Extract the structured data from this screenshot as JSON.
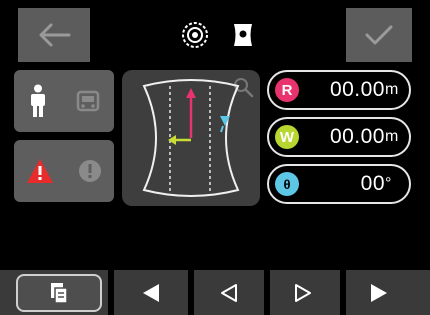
{
  "toolbar": {
    "back_icon": "arrow-left-icon",
    "confirm_icon": "checkmark-icon",
    "mode_icons": [
      "target-ring-icon",
      "shield-block-icon"
    ]
  },
  "side_panel": {
    "row1_icons": [
      "person-icon",
      "vehicle-icon"
    ],
    "row2_icons": [
      "warning-triangle-icon",
      "info-circle-icon"
    ]
  },
  "readouts": [
    {
      "badge": "R",
      "value": "00.00",
      "unit": "m",
      "color": "#e8336e"
    },
    {
      "badge": "W",
      "value": "00.00",
      "unit": "m",
      "color": "#b7d630"
    },
    {
      "badge": "θ",
      "value": "00",
      "unit": "°",
      "color": "#5fc7e6"
    }
  ],
  "navigation": {
    "icons": [
      "copy-icon",
      "first-triangle-icon",
      "prev-triangle-outline-icon",
      "next-triangle-outline-icon",
      "last-triangle-icon"
    ]
  },
  "colors": {
    "accent_red": "#e8336e",
    "accent_green": "#b7d630",
    "accent_cyan": "#5fc7e6",
    "panel_gray": "#5e5e5e"
  }
}
